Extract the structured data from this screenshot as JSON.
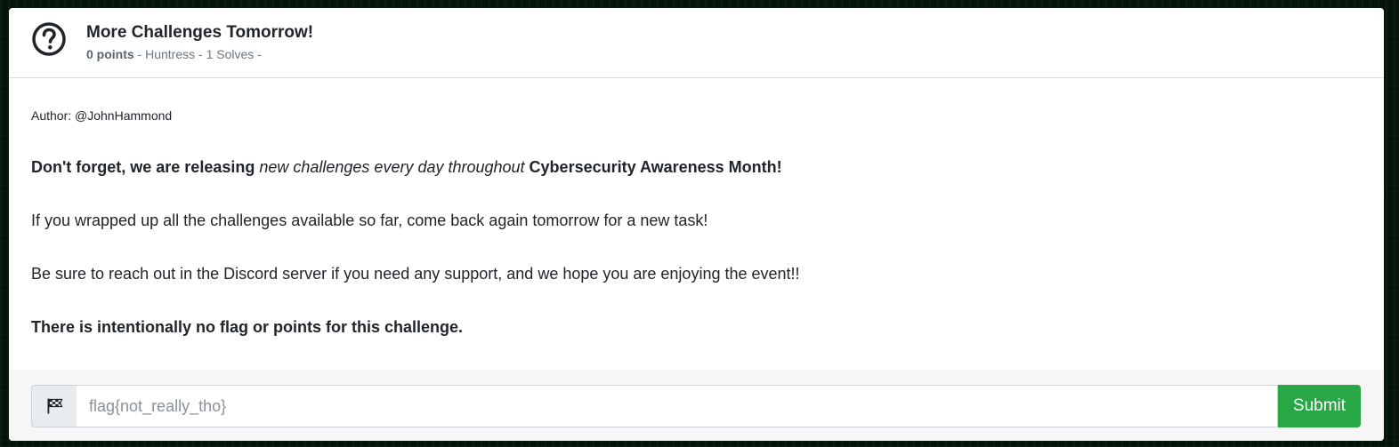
{
  "challenge": {
    "title": "More Challenges Tomorrow!",
    "points": "0 points",
    "meta_rest": " - Huntress - 1 Solves -",
    "help_icon": "question-circle-icon"
  },
  "body": {
    "author": "Author: @JohnHammond",
    "p1_bold_start": "Don't forget, we are releasing ",
    "p1_italic": "new challenges every day throughout",
    "p1_bold_end": " Cybersecurity Awareness Month!",
    "p2": "If you wrapped up all the challenges available so far, come back again tomorrow for a new task!",
    "p3": "Be sure to reach out in the Discord server if you need any support, and we hope you are enjoying the event!!",
    "p4": "There is intentionally no flag or points for this challenge."
  },
  "footer": {
    "flag_icon": "checkered-flag-icon",
    "flag_placeholder": "flag{not_really_tho}",
    "flag_value": "",
    "submit_label": "Submit"
  },
  "colors": {
    "submit": "#28a745",
    "background": "#07140b"
  }
}
